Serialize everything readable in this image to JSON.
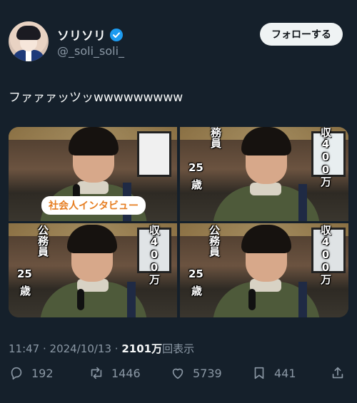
{
  "user": {
    "name": "ソリソリ",
    "handle": "@_soli_soli_",
    "follow_label": "フォローする"
  },
  "tweet": {
    "text": "ファァァッツッwwwwwwwww"
  },
  "media": {
    "cells": [
      {
        "badge": "社会人インタビュー"
      },
      {
        "left_vertical": "務員",
        "left_age_1": "25",
        "left_age_2": "歳",
        "right_vertical": "収400万"
      },
      {
        "left_vertical": "公務員",
        "left_age_1": "25",
        "left_age_2": "歳",
        "right_vertical": "収400万"
      },
      {
        "left_vertical": "公務員",
        "left_age_1": "25",
        "left_age_2": "歳",
        "right_vertical": "収400万"
      }
    ]
  },
  "meta": {
    "time": "11:47",
    "sep1": " · ",
    "date": "2024/10/13",
    "sep2": " · ",
    "views_count": "2101万",
    "views_label": "回表示"
  },
  "actions": {
    "reply_count": "192",
    "retweet_count": "1446",
    "like_count": "5739",
    "bookmark_count": "441"
  },
  "icons": {
    "verified": "verified-badge-icon",
    "reply": "reply-icon",
    "retweet": "retweet-icon",
    "like": "like-icon",
    "bookmark": "bookmark-icon",
    "share": "share-icon"
  },
  "colors": {
    "background": "#15202b",
    "verified": "#1d9bf0",
    "secondary_text": "#8b98a5",
    "badge_text": "#e67e22"
  }
}
